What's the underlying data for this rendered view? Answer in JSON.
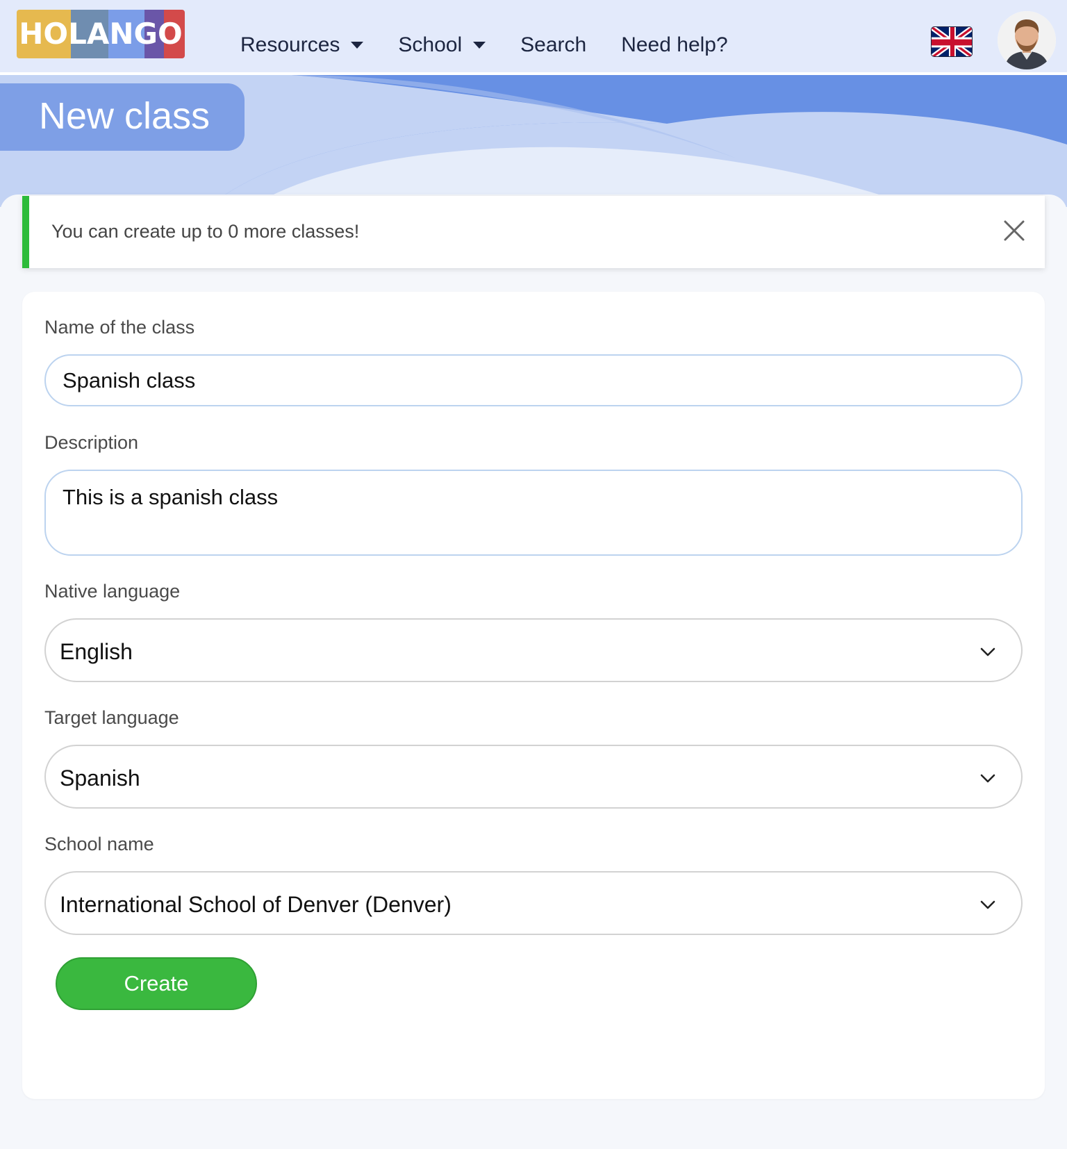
{
  "navbar": {
    "logo_text": "HOLANGO",
    "links": [
      {
        "label": "Resources",
        "dropdown": true
      },
      {
        "label": "School",
        "dropdown": true
      },
      {
        "label": "Search",
        "dropdown": false
      },
      {
        "label": "Need help?",
        "dropdown": false
      }
    ],
    "language_flag_icon": "uk-flag-icon",
    "avatar_icon": "user-avatar"
  },
  "header": {
    "page_title": "New class"
  },
  "alert": {
    "message": "You can create up to 0 more classes!",
    "accent_color": "#2dbb3a",
    "close_icon": "close-icon"
  },
  "form": {
    "name_label": "Name of the class",
    "name_value": "Spanish class",
    "description_label": "Description",
    "description_value": "This is a spanish class",
    "native_language_label": "Native language",
    "native_language_value": "English",
    "target_language_label": "Target language",
    "target_language_value": "Spanish",
    "school_label": "School name",
    "school_value": "International School of Denver (Denver)",
    "create_label": "Create"
  },
  "colors": {
    "primary_button": "#3ab83f",
    "banner": "#6790e4",
    "navbar": "#e3eafb"
  }
}
